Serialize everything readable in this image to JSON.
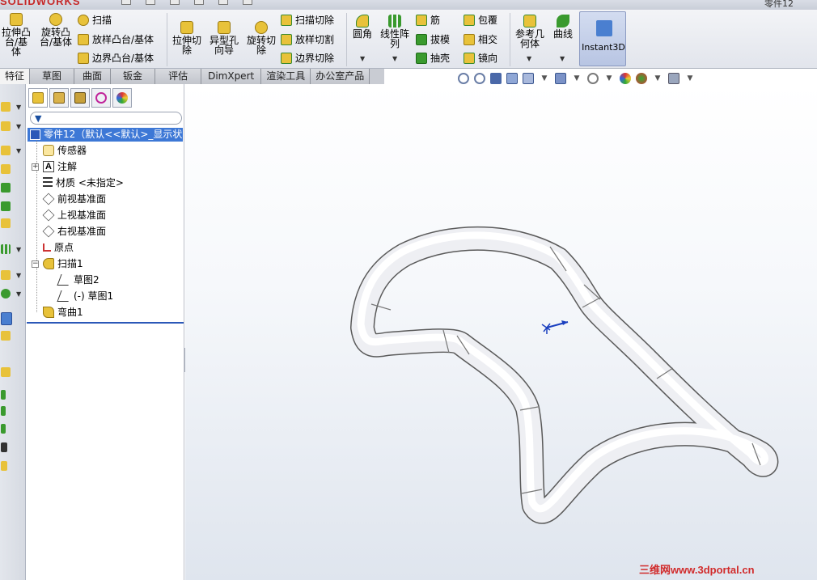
{
  "app": {
    "logo": "SOLIDWORKS",
    "title_partial": "零件12"
  },
  "ribbon": {
    "extrude_boss": "拉伸凸\n台/基体",
    "revolve_boss": "旋转凸\n台/基体",
    "sweep": "扫描",
    "loft_boss": "放样凸台/基体",
    "boundary_boss": "边界凸台/基体",
    "extrude_cut": "拉伸切\n除",
    "hole_wizard": "异型孔\n向导",
    "revolve_cut": "旋转切\n除",
    "sweep_cut": "扫描切除",
    "loft_cut": "放样切割",
    "boundary_cut": "边界切除",
    "fillet": "圆角",
    "linear_pattern": "线性阵\n列",
    "rib": "筋",
    "draft": "拔模",
    "shell": "抽壳",
    "wrap": "包覆",
    "intersect": "相交",
    "mirror": "镜向",
    "ref_geometry": "参考几\n何体",
    "curves": "曲线",
    "instant3d": "Instant3D"
  },
  "tabs": [
    {
      "label": "特征"
    },
    {
      "label": "草图"
    },
    {
      "label": "曲面"
    },
    {
      "label": "钣金"
    },
    {
      "label": "评估"
    },
    {
      "label": "DimXpert"
    },
    {
      "label": "渲染工具"
    },
    {
      "label": "办公室产品"
    }
  ],
  "tree": {
    "root": "零件12（默认<<默认>_显示状",
    "items": [
      {
        "label": "传感器"
      },
      {
        "label": "注解"
      },
      {
        "label": "材质 <未指定>"
      },
      {
        "label": "前视基准面"
      },
      {
        "label": "上视基准面"
      },
      {
        "label": "右视基准面"
      },
      {
        "label": "原点"
      },
      {
        "label": "扫描1"
      },
      {
        "label": "草图2"
      },
      {
        "label": "(-) 草图1"
      },
      {
        "label": "弯曲1"
      }
    ]
  },
  "watermark": "三维网www.3dportal.cn",
  "colors": {
    "accent": "#3d78d6",
    "tree_select": "#3d78d6",
    "watermark": "#d12b2b"
  }
}
